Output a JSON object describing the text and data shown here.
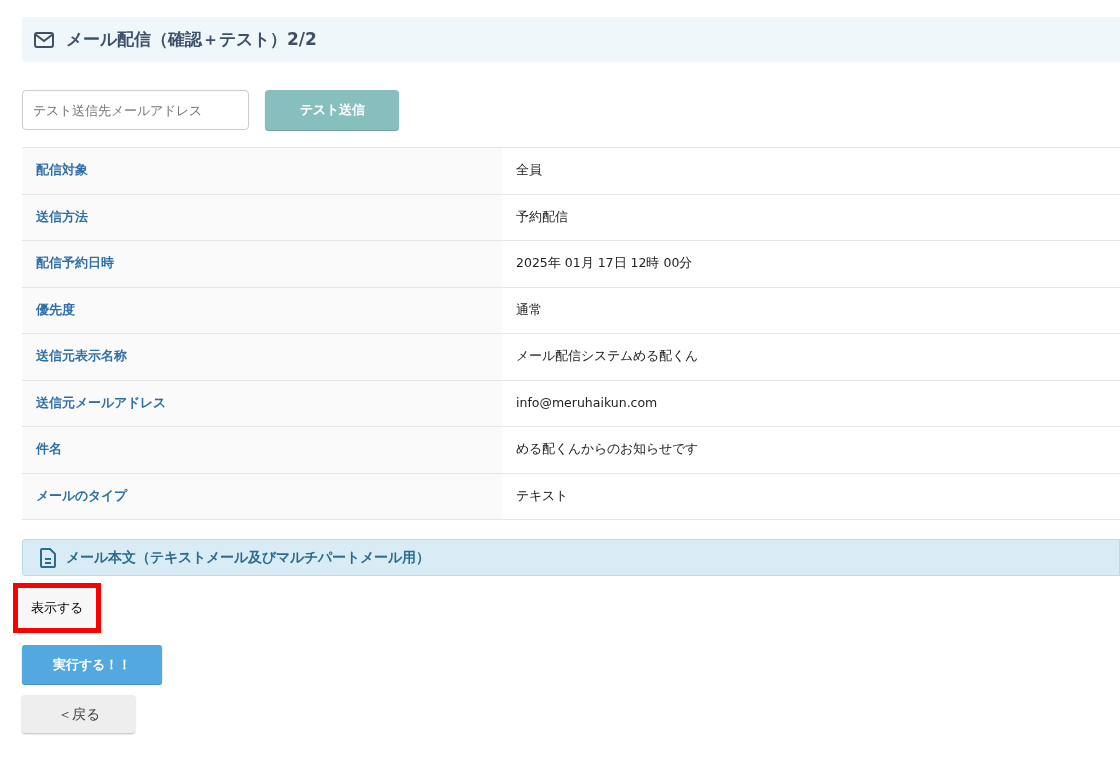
{
  "header": {
    "title": "メール配信（確認＋テスト）2/2"
  },
  "test_send": {
    "placeholder": "テスト送信先メールアドレス",
    "button": "テスト送信"
  },
  "details": [
    {
      "label": "配信対象",
      "value": "全員"
    },
    {
      "label": "送信方法",
      "value": "予約配信"
    },
    {
      "label": "配信予約日時",
      "value": "2025年 01月 17日 12時 00分"
    },
    {
      "label": "優先度",
      "value": "通常"
    },
    {
      "label": "送信元表示名称",
      "value": "メール配信システムめる配くん"
    },
    {
      "label": "送信元メールアドレス",
      "value": "info@meruhaikun.com"
    },
    {
      "label": "件名",
      "value": "める配くんからのお知らせです"
    },
    {
      "label": "メールのタイプ",
      "value": "テキスト"
    }
  ],
  "body_section": {
    "title": "メール本文（テキストメール及びマルチパートメール用）",
    "show_button": "表示する",
    "highlighted": true
  },
  "buttons": [
    {
      "kind": "primary",
      "label": "実行する！！"
    },
    {
      "kind": "back",
      "label": "＜戻る"
    }
  ]
}
